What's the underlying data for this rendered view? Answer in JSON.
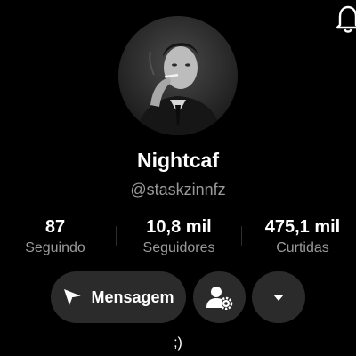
{
  "profile": {
    "display_name": "Nightcaf",
    "username": "@staskzinnfz",
    "bio": ";)"
  },
  "stats": {
    "following": {
      "value": "87",
      "label": "Seguindo"
    },
    "followers": {
      "value": "10,8 mil",
      "label": "Seguidores"
    },
    "likes": {
      "value": "475,1 mil",
      "label": "Curtidas"
    }
  },
  "actions": {
    "message_label": "Mensagem",
    "message_icon": "send-icon",
    "add_friend_icon": "person-settings-icon",
    "more_icon": "caret-down-icon"
  },
  "header": {
    "notification_icon": "bell-icon"
  },
  "colors": {
    "background": "#000000",
    "button_background": "#2b2b2b",
    "secondary_text": "#9a9a9a"
  }
}
